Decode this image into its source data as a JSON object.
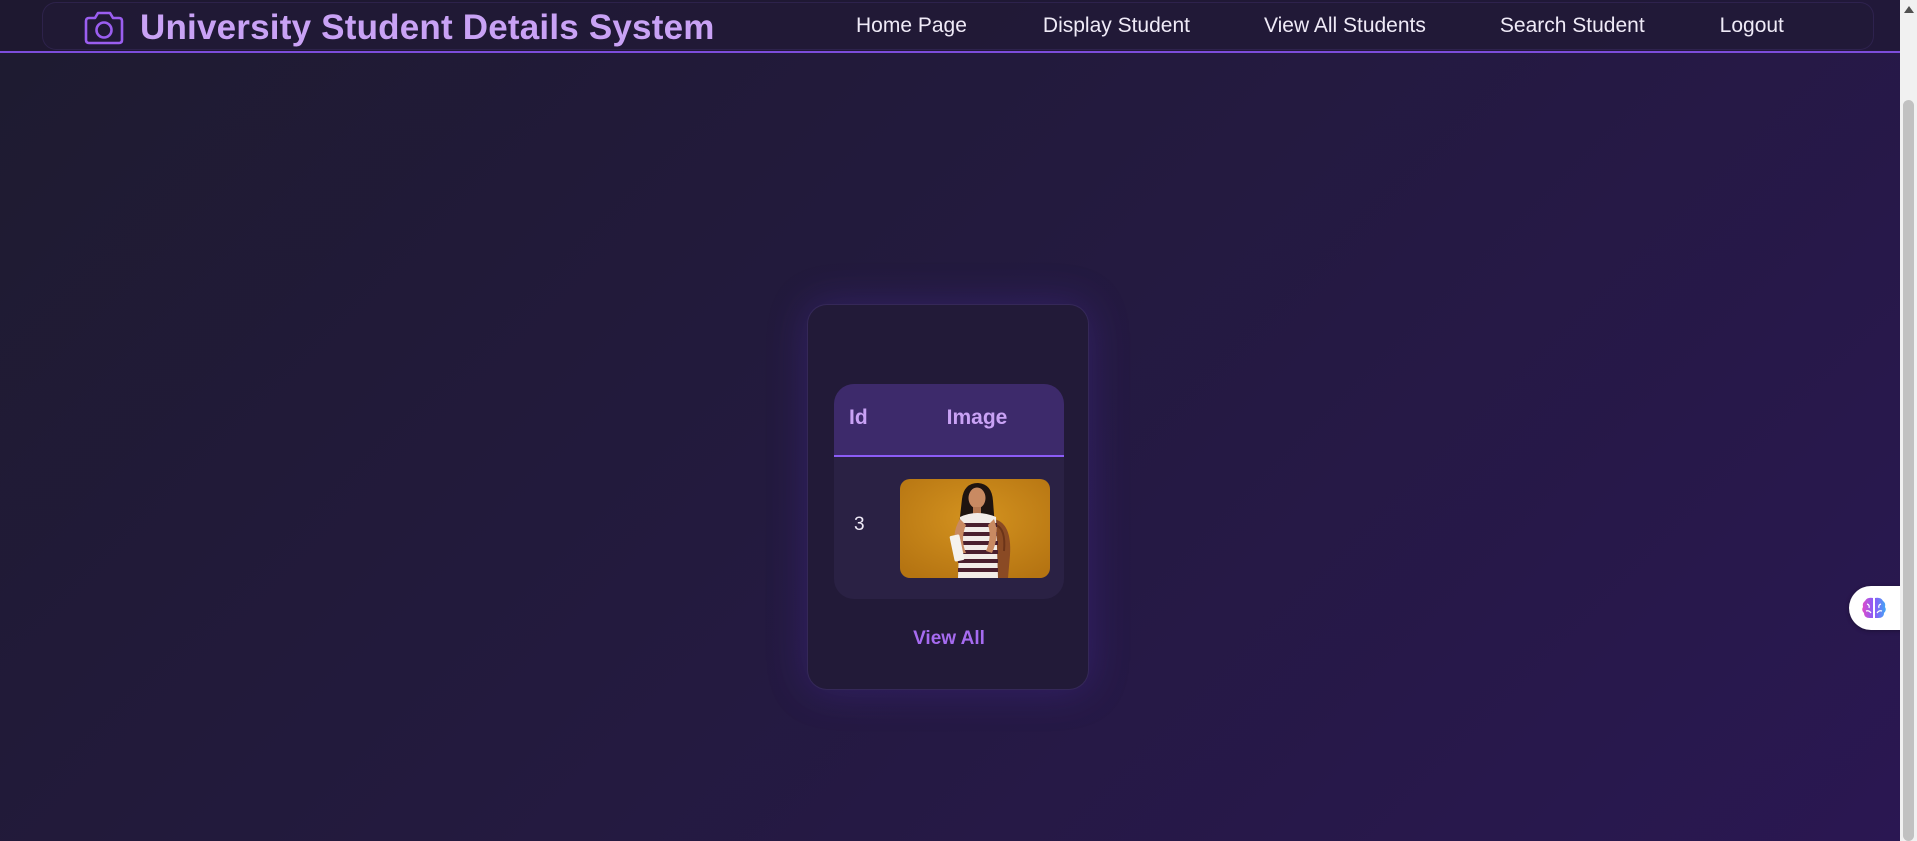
{
  "header": {
    "brand_icon": "camera-icon",
    "title": "University Student Details System",
    "nav": [
      {
        "label": "Home Page"
      },
      {
        "label": "Display Student"
      },
      {
        "label": "View All Students"
      },
      {
        "label": "Search Student"
      },
      {
        "label": "Logout"
      }
    ]
  },
  "table": {
    "columns": [
      "Id",
      "Image"
    ],
    "rows": [
      {
        "id": "3",
        "image": "student-photo"
      }
    ]
  },
  "card": {
    "link_label": "View All"
  },
  "widget": {
    "icon": "brain-icon"
  },
  "colors": {
    "accent": "#8b5cf6",
    "brand_text": "#c9a2f5",
    "link": "#a66bf0",
    "background_dark": "#1e1b30",
    "background_purple": "#2a1752"
  }
}
